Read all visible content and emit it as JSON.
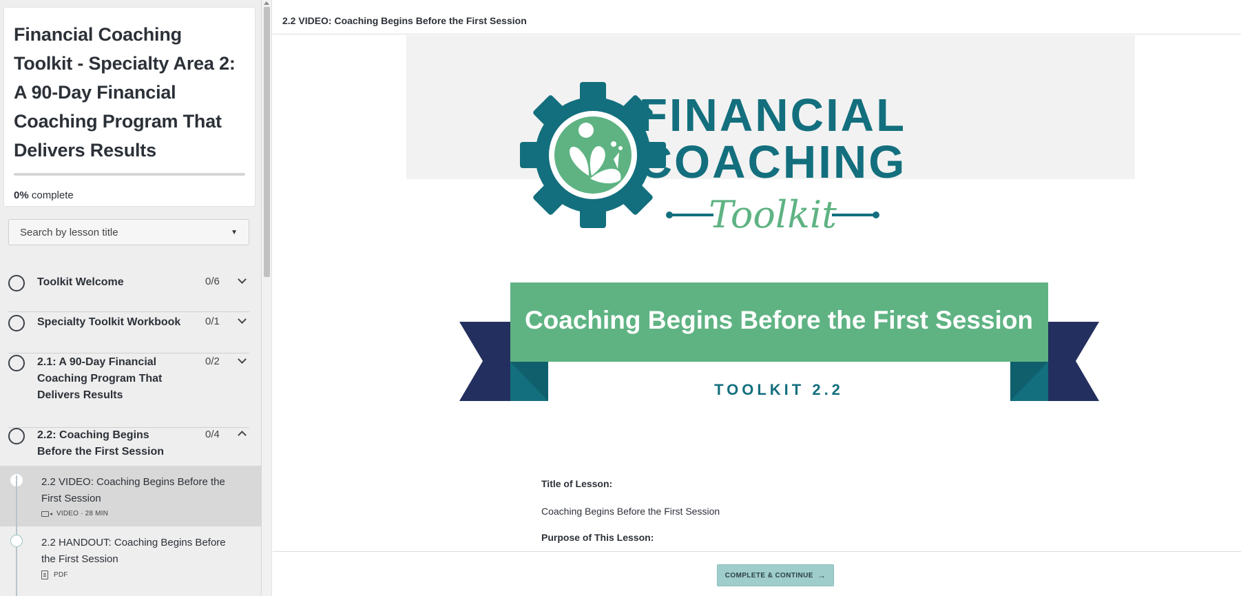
{
  "course": {
    "title": "Financial Coaching Toolkit - Specialty Area 2: A 90-Day Financial Coaching Program That Delivers Results",
    "progress_percent": 0,
    "progress_value": "0%",
    "progress_suffix": " complete"
  },
  "search": {
    "placeholder": "Search by lesson title"
  },
  "chapters": [
    {
      "title": "Toolkit Welcome",
      "count": "0/6"
    },
    {
      "title": "Specialty Toolkit Workbook",
      "count": "0/1"
    },
    {
      "title": "2.1: A 90-Day Financial Coaching Program That Delivers Results",
      "count": "0/2"
    },
    {
      "title": "2.2: Coaching Begins Before the First Session",
      "count": "0/4"
    }
  ],
  "lessons": [
    {
      "title": "2.2 VIDEO: Coaching Begins Before the First Session",
      "meta": "VIDEO · 28 MIN"
    },
    {
      "title": "2.2 HANDOUT: Coaching Begins Before the First Session",
      "meta": "PDF"
    }
  ],
  "main": {
    "header_title": "2.2 VIDEO: Coaching Begins Before the First Session",
    "logo": {
      "line1": "FINANCIAL",
      "line2": "COACHING",
      "script": "Toolkit"
    },
    "banner": {
      "title": "Coaching Begins Before the First Session",
      "subtitle": "TOOLKIT 2.2"
    },
    "body": {
      "title_label": "Title of Lesson:",
      "title_value": "Coaching Begins Before the First Session",
      "purpose_label": "Purpose of This Lesson:"
    },
    "complete_button": "COMPLETE & CONTINUE",
    "complete_arrow": "→"
  },
  "colors": {
    "teal": "#136f7d",
    "green": "#5fb383",
    "navy": "#23305f",
    "button": "#9ecdcc"
  }
}
